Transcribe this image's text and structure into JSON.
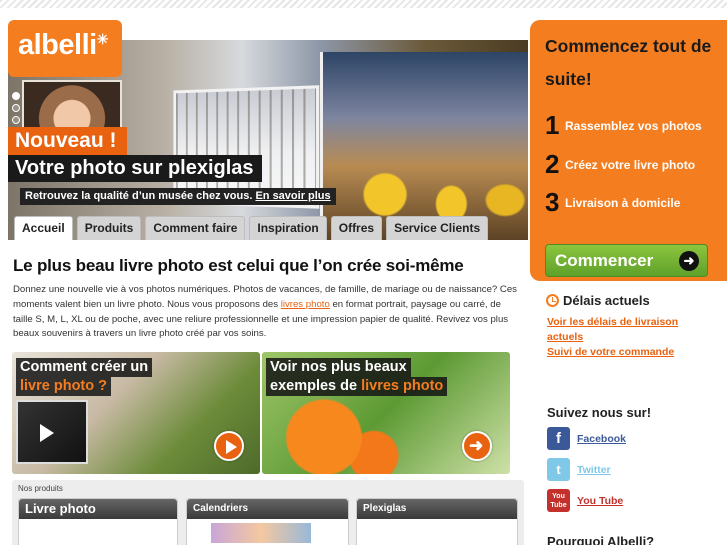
{
  "brand": {
    "logo_text": "albelli",
    "accent": "#f47d20",
    "green": "#5ea12a"
  },
  "hero": {
    "badge": "Nouveau !",
    "title": "Votre photo sur plexiglas",
    "subtitle": "Retrouvez la qualité d’un musée chez vous.",
    "more_link": "En savoir plus",
    "slides_active": 1
  },
  "tabs": [
    {
      "label": "Accueil",
      "active": true
    },
    {
      "label": "Produits"
    },
    {
      "label": "Comment faire"
    },
    {
      "label": "Inspiration"
    },
    {
      "label": "Offres"
    },
    {
      "label": "Service Clients"
    }
  ],
  "main": {
    "headline": "Le plus beau livre photo est celui que l’on crée soi-même",
    "intro_before": "Donnez une nouvelle vie à vos photos numériques. Photos de vacances, de famille, de mariage ou de naissance? Ces moments valent bien un livre photo. Nous vous proposons des ",
    "intro_link": "livres photo",
    "intro_after": " en format portrait, paysage ou carré, de taille S, M, L, XL ou de poche, avec une reliure professionnelle et une impression papier de qualité. Revivez vos plus beaux souvenirs à travers un livre photo créé par vos soins."
  },
  "features": {
    "howto_line1": "Comment créer  un",
    "howto_line2_hl": "livre photo ?",
    "examples_line1": "Voir nos plus beaux",
    "examples_line2": "exemples de ",
    "examples_line2_hl": "livres photo"
  },
  "products": {
    "label": "Nos produits",
    "items": [
      "Livre photo",
      "Calendriers",
      "Plexiglas"
    ]
  },
  "cta": {
    "title": "Commencez tout de suite!",
    "steps": [
      {
        "num": "1",
        "text": "Rassemblez vos photos"
      },
      {
        "num": "2",
        "text": "Créez votre livre photo"
      },
      {
        "num": "3",
        "text": "Livraison à domicile"
      }
    ],
    "button": "Commencer"
  },
  "delivery": {
    "heading": "Délais actuels",
    "link1": "Voir les délais de livraison actuels",
    "link2": "Suivi de votre commande"
  },
  "social": {
    "heading": "Suivez nous sur!",
    "items": [
      {
        "label": "Facebook",
        "icon": "facebook-icon"
      },
      {
        "label": "Twitter",
        "icon": "twitter-icon"
      },
      {
        "label": "You Tube",
        "icon": "youtube-icon"
      }
    ]
  },
  "why": {
    "heading": "Pourquoi Albelli?"
  }
}
